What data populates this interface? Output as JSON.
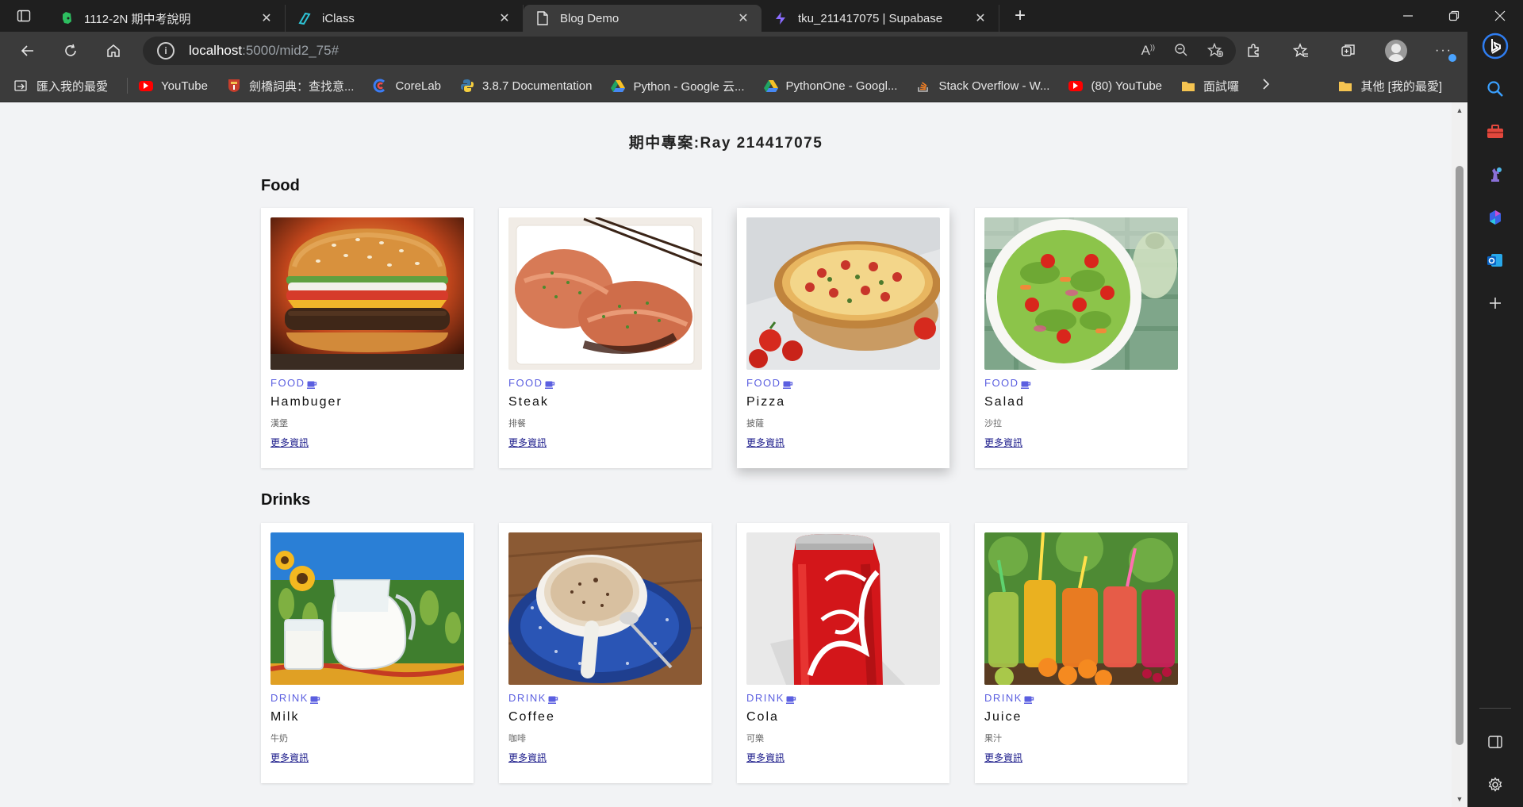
{
  "browser": {
    "tabs": [
      {
        "title": "1112-2N 期中考說明",
        "icon": "evernote-icon",
        "active": false
      },
      {
        "title": "iClass",
        "icon": "iclass-icon",
        "active": false
      },
      {
        "title": "Blog Demo",
        "icon": "document-icon",
        "active": true
      },
      {
        "title": "tku_211417075 | Supabase",
        "icon": "supabase-icon",
        "active": false
      }
    ],
    "close_glyph": "✕",
    "new_tab_glyph": "+",
    "address": {
      "host": "localhost",
      "path": ":5000/mid2_75#"
    },
    "bookmarks": [
      {
        "label": "匯入我的最愛",
        "icon": "import-icon"
      },
      {
        "label": "YouTube",
        "icon": "youtube-icon"
      },
      {
        "label": "劍橋詞典：查找意...",
        "icon": "cambridge-icon"
      },
      {
        "label": "CoreLab",
        "icon": "corelab-icon"
      },
      {
        "label": "3.8.7 Documentation",
        "icon": "python-icon"
      },
      {
        "label": "Python - Google 云...",
        "icon": "google-drive-icon"
      },
      {
        "label": "PythonOne - Googl...",
        "icon": "google-drive-icon"
      },
      {
        "label": "Stack Overflow - W...",
        "icon": "stackoverflow-icon"
      },
      {
        "label": "(80) YouTube",
        "icon": "youtube-icon"
      },
      {
        "label": "面試囉",
        "icon": "folder-icon"
      }
    ],
    "other_favorites": "其他 [我的最愛]",
    "colors": {
      "tab_bg": "#1f1f1f",
      "toolbar_bg": "#3b3b3b",
      "page_bg": "#f2f3f5",
      "accent": "#5b5fe0"
    }
  },
  "page": {
    "title": "期中專案:Ray 214417075",
    "more_label": "更多資訊",
    "sections": [
      {
        "title": "Food",
        "items": [
          {
            "category": "FOOD",
            "name": "Hambuger",
            "desc": "漢堡",
            "image": "hamburger-image"
          },
          {
            "category": "FOOD",
            "name": "Steak",
            "desc": "排餐",
            "image": "steak-image"
          },
          {
            "category": "FOOD",
            "name": "Pizza",
            "desc": "披薩",
            "image": "pizza-image"
          },
          {
            "category": "FOOD",
            "name": "Salad",
            "desc": "沙拉",
            "image": "salad-image"
          }
        ]
      },
      {
        "title": "Drinks",
        "items": [
          {
            "category": "DRINK",
            "name": "Milk",
            "desc": "牛奶",
            "image": "milk-image"
          },
          {
            "category": "DRINK",
            "name": "Coffee",
            "desc": "咖啡",
            "image": "coffee-image"
          },
          {
            "category": "DRINK",
            "name": "Cola",
            "desc": "可樂",
            "image": "cola-image"
          },
          {
            "category": "DRINK",
            "name": "Juice",
            "desc": "果汁",
            "image": "juice-image"
          }
        ]
      }
    ]
  }
}
